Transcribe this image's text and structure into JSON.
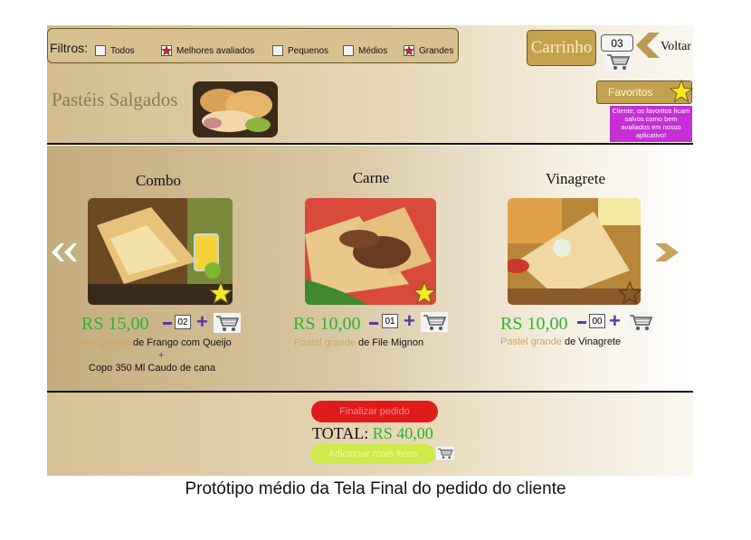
{
  "filters": {
    "label": "Filtros:",
    "options": [
      {
        "label": "Todos",
        "checked": false
      },
      {
        "label": "Melhores avaliados",
        "checked": true
      },
      {
        "label": "Pequenos",
        "checked": false
      },
      {
        "label": "Médios",
        "checked": false
      },
      {
        "label": "Grandes",
        "checked": true
      }
    ]
  },
  "header": {
    "cart_label": "Carrinho",
    "cart_count": "03",
    "back_label": "Voltar",
    "favorites_label": "Favoritos",
    "favorites_note": "Cliente, os favoritos ficam salvos como bem avaliados em nosso aplicativo!",
    "section_title": "Pastéis Salgados"
  },
  "products": [
    {
      "name": "Combo",
      "price": "RS 15,00",
      "qty": "02",
      "favorite": true,
      "desc_highlight": "Pastel grande",
      "desc_rest": " de Frango com Queijo",
      "desc_plus": "+",
      "desc_extra": "Copo 350 Ml Caudo de cana"
    },
    {
      "name": "Carne",
      "price": "RS 10,00",
      "qty": "01",
      "favorite": true,
      "desc_highlight": "Pastel grande",
      "desc_rest": " de File Mignon"
    },
    {
      "name": "Vinagrete",
      "price": "RS 10,00",
      "qty": "00",
      "favorite": false,
      "desc_highlight": "Pastel grande",
      "desc_rest": " de Vinagrete"
    }
  ],
  "footer": {
    "finalize_label": "Finalizar pedido",
    "total_label": "TOTAL:",
    "total_value": "RS 40,00",
    "add_more_label": "Adicionar mais itens"
  },
  "caption": "Protótipo médio da Tela Final do pedido do cliente",
  "colors": {
    "gold": "#c3a14f",
    "price_green": "#2db32d",
    "stepper_purple": "#5a35a8",
    "finalize_red": "#e01b1b",
    "add_more_lime": "#cfe84a",
    "favorites_note": "#c62fd6"
  }
}
